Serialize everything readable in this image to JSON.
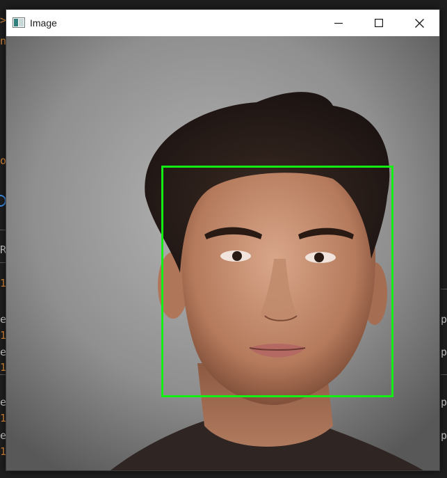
{
  "window": {
    "title": "Image",
    "app_icon": "image-window-icon",
    "controls": {
      "minimize_icon": "minimize-icon",
      "maximize_icon": "maximize-icon",
      "close_icon": "close-icon"
    }
  },
  "image": {
    "subject": "portrait photo",
    "detection_box_color": "#13f013"
  },
  "background_fragments": {
    "left": [
      ">",
      "n",
      "o",
      "R",
      "1",
      "e",
      "1",
      "e",
      "1",
      "e",
      "1",
      "e",
      "1"
    ],
    "right": [
      "p",
      "p",
      "p",
      "p"
    ]
  }
}
